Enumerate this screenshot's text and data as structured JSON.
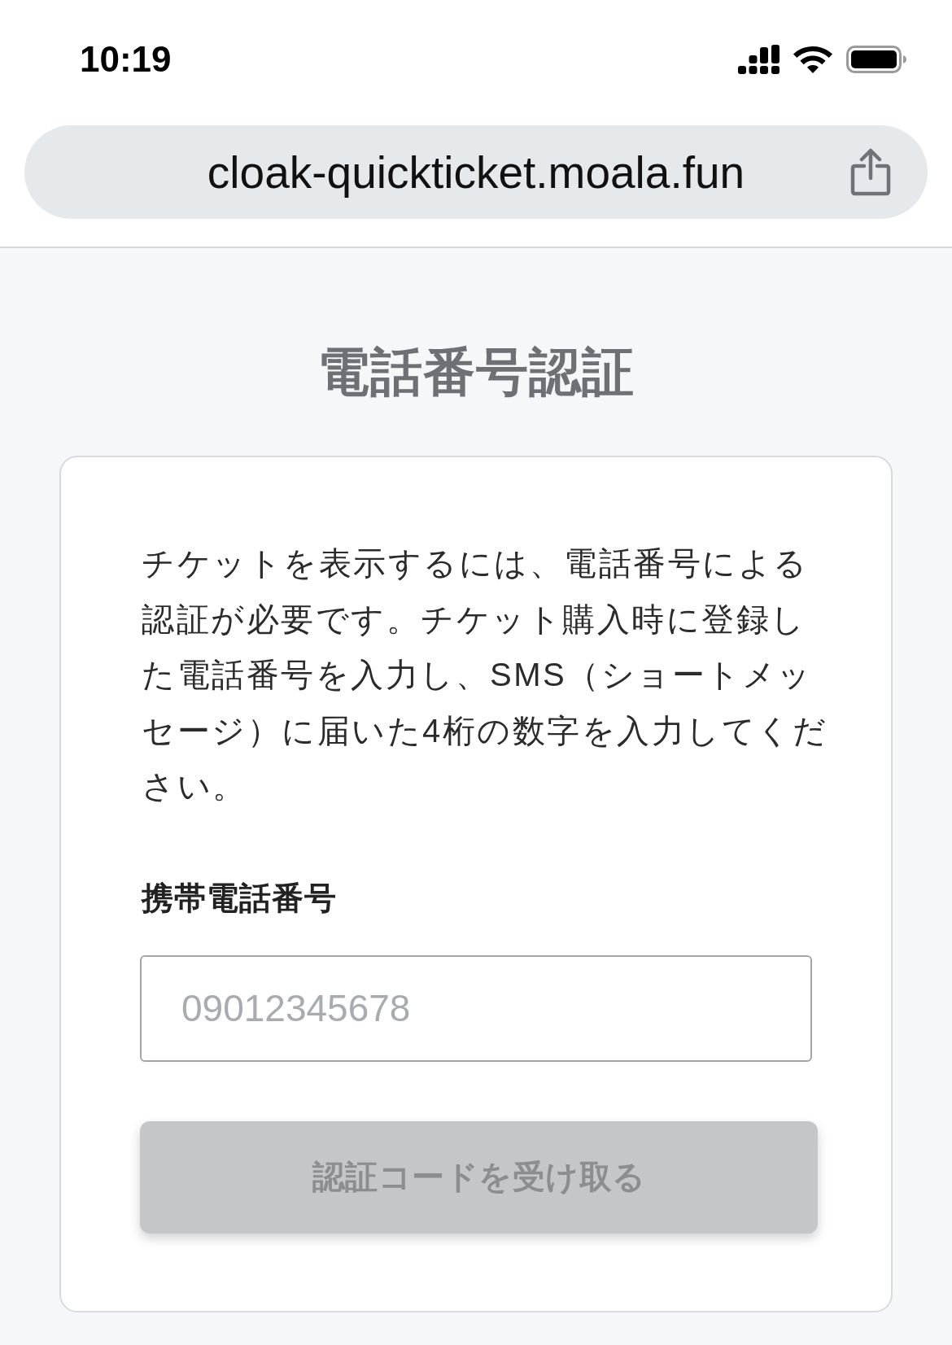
{
  "status_bar": {
    "time": "10:19"
  },
  "address_bar": {
    "url": "cloak-quickticket.moala.fun"
  },
  "page": {
    "title": "電話番号認証",
    "description": "チケットを表示するには、電話番号による認証が必要です。チケット購入時に登録した電話番号を入力し、SMS（ショートメッセージ）に届いた4桁の数字を入力してください。",
    "phone_field": {
      "label": "携帯電話番号",
      "placeholder": "09012345678"
    },
    "submit_button": {
      "label": "認証コードを受け取る",
      "disabled": true
    }
  }
}
